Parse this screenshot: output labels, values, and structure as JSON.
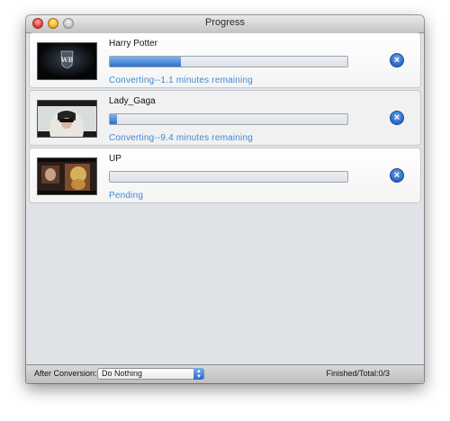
{
  "window": {
    "title": "Progress"
  },
  "items": [
    {
      "title": "Harry Potter",
      "progress": 0.3,
      "status": "Converting--1.1 minutes remaining",
      "thumbnail": "wb-logo-dark-frame"
    },
    {
      "title": "Lady_Gaga",
      "progress": 0.03,
      "status": "Converting--9.4 minutes remaining",
      "thumbnail": "lady-gaga-frame"
    },
    {
      "title": "UP",
      "progress": 0,
      "status": "Pending",
      "thumbnail": "up-movie-frame"
    }
  ],
  "bottom": {
    "after_label": "After Conversion:",
    "after_value": "Do Nothing",
    "finished_text": "Finished/Total:0/3"
  },
  "colors": {
    "accent": "#2e70c9",
    "status_text": "#3e8ad6"
  }
}
